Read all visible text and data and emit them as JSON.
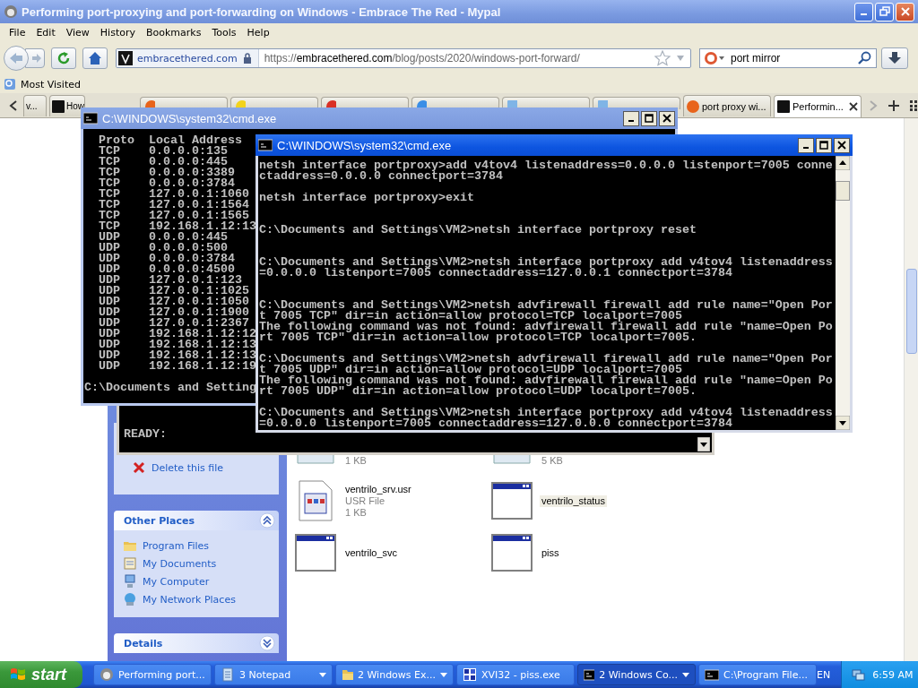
{
  "browser": {
    "title": "Performing port-proxying and port-forwarding on Windows - Embrace The Red - Mypal",
    "menu": [
      "File",
      "Edit",
      "View",
      "History",
      "Bookmarks",
      "Tools",
      "Help"
    ],
    "identity": "embracethered.com",
    "url": [
      "https://",
      "embracethered.com",
      "/blog/posts/2020/windows-port-forward/"
    ],
    "search": {
      "value": "port mirror"
    },
    "bookmarks": [
      {
        "label": "Most Visited"
      }
    ],
    "tabs": [
      {
        "label": "v...",
        "selected": false
      },
      {
        "label": "How",
        "kind": "square",
        "color": "#111111",
        "selected": false
      },
      {
        "kind": "circle",
        "color": "#e8641b",
        "selected": false
      },
      {
        "kind": "circle",
        "color": "#f2d31c",
        "selected": false
      },
      {
        "kind": "circle",
        "color": "#d93025",
        "selected": false
      },
      {
        "kind": "circle",
        "color": "#3a8ee6",
        "selected": false
      },
      {
        "kind": "square",
        "color": "#7fb4e6",
        "selected": false
      },
      {
        "kind": "square",
        "color": "#7fb4e6",
        "selected": false
      },
      {
        "label": "port proxy wi...",
        "kind": "circle",
        "color": "#e8641b",
        "selected": false
      },
      {
        "label": "Performin...",
        "kind": "square",
        "color": "#111111",
        "selected": true
      }
    ]
  },
  "page": {
    "panes": [
      {
        "kind": "tasks",
        "items": [
          {
            "label": "Delete this file",
            "kind": "delete"
          }
        ]
      },
      {
        "kind": "places",
        "title": "Other Places",
        "expanded": true,
        "items": [
          {
            "label": "Program Files",
            "kind": "folder"
          },
          {
            "label": "My Documents",
            "kind": "documents"
          },
          {
            "label": "My Computer",
            "kind": "computer"
          },
          {
            "label": "My Network Places",
            "kind": "network"
          }
        ]
      },
      {
        "kind": "details",
        "title": "Details",
        "expanded": false
      }
    ],
    "files": [
      {
        "size": "1 KB",
        "kind": "document"
      },
      {
        "size": "5 KB",
        "kind": "document"
      },
      {
        "name": "ventrilo_srv.usr",
        "type": "USR File",
        "size": "1 KB",
        "kind": "usr",
        "selected": false
      },
      {
        "name": "ventrilo_status",
        "kind": "app",
        "selected": true
      },
      {
        "name": "ventrilo_svc",
        "kind": "app",
        "selected": false
      },
      {
        "name": "piss",
        "kind": "app",
        "selected": false
      }
    ],
    "console": {
      "text": "READY:"
    }
  },
  "consoles": [
    {
      "title": "C:\\WINDOWS\\system32\\cmd.exe",
      "active": false,
      "text": "  Proto  Local Address\n  TCP    0.0.0.0:135\n  TCP    0.0.0.0:445\n  TCP    0.0.0.0:3389\n  TCP    0.0.0.0:3784\n  TCP    127.0.0.1:1060\n  TCP    127.0.0.1:1564\n  TCP    127.0.0.1:1565\n  TCP    192.168.1.12:13\n  UDP    0.0.0.0:445\n  UDP    0.0.0.0:500\n  UDP    0.0.0.0:3784\n  UDP    0.0.0.0:4500\n  UDP    127.0.0.1:123\n  UDP    127.0.0.1:1025\n  UDP    127.0.0.1:1050\n  UDP    127.0.0.1:1900\n  UDP    127.0.0.1:2367\n  UDP    192.168.1.12:12\n  UDP    192.168.1.12:13\n  UDP    192.168.1.12:13\n  UDP    192.168.1.12:19\n\nC:\\Documents and Setting"
    },
    {
      "title": "C:\\WINDOWS\\system32\\cmd.exe",
      "active": true,
      "text": "netsh interface portproxy>add v4tov4 listenaddress=0.0.0.0 listenport=7005 conne\nctaddress=0.0.0.0 connectport=3784\n\nnetsh interface portproxy>exit\n\n\nC:\\Documents and Settings\\VM2>netsh interface portproxy reset\n\n\nC:\\Documents and Settings\\VM2>netsh interface portproxy add v4tov4 listenaddress\n=0.0.0.0 listenport=7005 connectaddress=127.0.0.1 connectport=3784\n\n\nC:\\Documents and Settings\\VM2>netsh advfirewall firewall add rule name=\"Open Por\nt 7005 TCP\" dir=in action=allow protocol=TCP localport=7005\nThe following command was not found: advfirewall firewall add rule \"name=Open Po\nrt 7005 TCP\" dir=in action=allow protocol=TCP localport=7005.\n\nC:\\Documents and Settings\\VM2>netsh advfirewall firewall add rule name=\"Open Por\nt 7005 UDP\" dir=in action=allow protocol=UDP localport=7005\nThe following command was not found: advfirewall firewall add rule \"name=Open Po\nrt 7005 UDP\" dir=in action=allow protocol=UDP localport=7005.\n\nC:\\Documents and Settings\\VM2>netsh interface portproxy add v4tov4 listenaddress\n=0.0.0.0 listenport=7005 connectaddress=127.0.0.0 connectport=3784"
    }
  ],
  "taskbar": {
    "start": "start",
    "tasks": [
      {
        "label": "Performing port...",
        "kind": "browser",
        "grouped": false,
        "selected": false
      },
      {
        "label": "3 Notepad",
        "kind": "notepad",
        "grouped": true,
        "selected": false
      },
      {
        "label": "2 Windows Ex...",
        "kind": "folder",
        "grouped": true,
        "selected": false
      },
      {
        "label": "XVI32 - piss.exe",
        "kind": "hex",
        "grouped": false,
        "selected": false
      },
      {
        "label": "2 Windows Co...",
        "kind": "console",
        "grouped": true,
        "selected": true
      },
      {
        "label": "C:\\Program File...",
        "kind": "console",
        "grouped": false,
        "selected": false
      }
    ],
    "language": "EN",
    "time": "6:59 AM"
  }
}
